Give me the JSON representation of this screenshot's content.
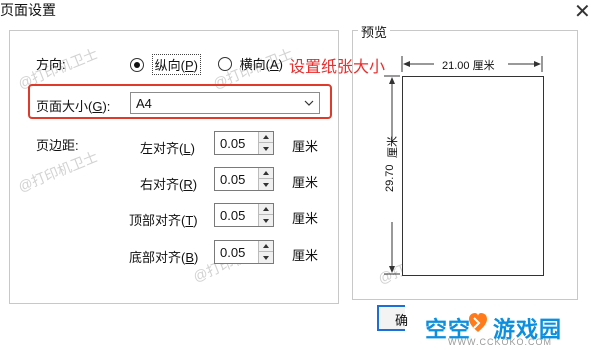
{
  "window": {
    "title": "页面设置",
    "close_glyph": "✕"
  },
  "orientation": {
    "label": "方向:",
    "options": [
      {
        "label": "纵向(",
        "key": "P",
        "suffix": ")",
        "selected": true
      },
      {
        "label": "横向(",
        "key": "A",
        "suffix": ")",
        "selected": false
      }
    ]
  },
  "annotation": {
    "text": "设置纸张大小",
    "color": "#ee2b2b"
  },
  "page_size": {
    "label": "页面大小(",
    "key": "G",
    "suffix": "):",
    "value": "A4"
  },
  "margins": {
    "label": "页边距:",
    "unit": "厘米",
    "fields": [
      {
        "name": "left",
        "label": "左对齐(",
        "key": "L",
        "suffix": ")",
        "value": "0.05"
      },
      {
        "name": "right",
        "label": "右对齐(",
        "key": "R",
        "suffix": ")",
        "value": "0.05"
      },
      {
        "name": "top",
        "label": "顶部对齐(",
        "key": "T",
        "suffix": ")",
        "value": "0.05"
      },
      {
        "name": "bottom",
        "label": "底部对齐(",
        "key": "B",
        "suffix": ")",
        "value": "0.05"
      }
    ]
  },
  "preview": {
    "label": "预览",
    "width_label": "21.00  厘米",
    "height_label": "29.70",
    "height_unit": "厘米"
  },
  "ok_button": {
    "label": "确"
  },
  "watermark": {
    "text": "@打印机卫士"
  },
  "brand": {
    "name": "空空",
    "name2": "游戏园",
    "sub": "WWW.CCKOKO.COM",
    "accent": "#0b8fe0",
    "heart": "#ff7a1a"
  }
}
